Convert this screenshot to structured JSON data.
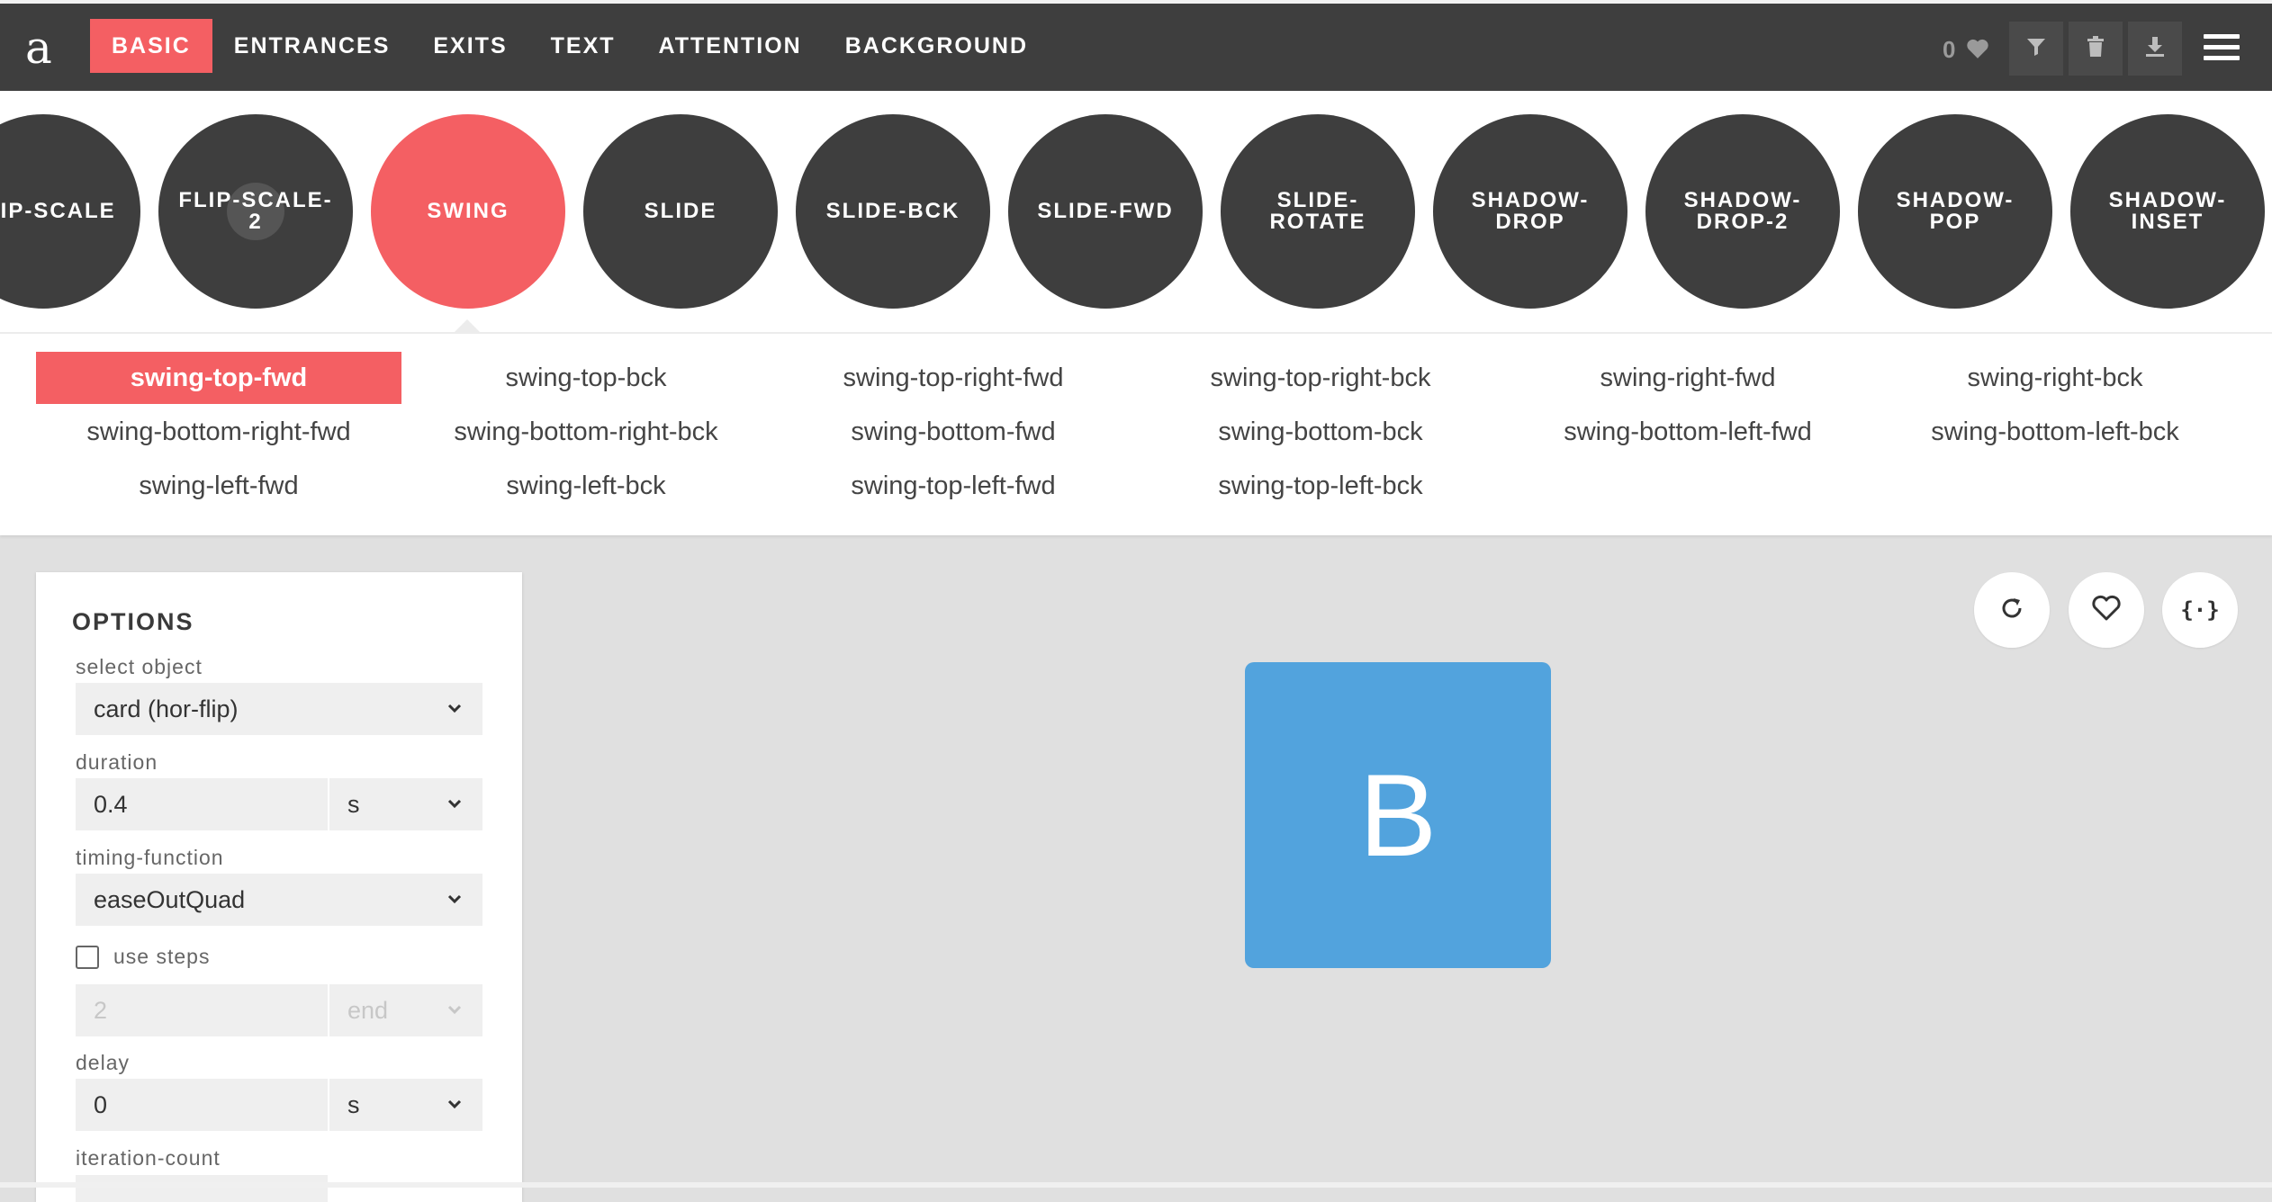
{
  "logo": "a",
  "nav": {
    "tabs": [
      {
        "label": "BASIC",
        "active": true
      },
      {
        "label": "ENTRANCES",
        "active": false
      },
      {
        "label": "EXITS",
        "active": false
      },
      {
        "label": "TEXT",
        "active": false
      },
      {
        "label": "ATTENTION",
        "active": false
      },
      {
        "label": "BACKGROUND",
        "active": false
      }
    ],
    "favorites_count": "0",
    "tools": [
      "filter-icon",
      "trash-icon",
      "download-icon"
    ],
    "menu_icon": "hamburger-icon"
  },
  "animations": [
    {
      "label": "FLIP-SCALE",
      "active": false
    },
    {
      "label": "FLIP-SCALE-2",
      "active": false
    },
    {
      "label": "SWING",
      "active": true
    },
    {
      "label": "SLIDE",
      "active": false
    },
    {
      "label": "SLIDE-BCK",
      "active": false
    },
    {
      "label": "SLIDE-FWD",
      "active": false
    },
    {
      "label": "SLIDE-ROTATE",
      "active": false
    },
    {
      "label": "SHADOW-DROP",
      "active": false
    },
    {
      "label": "SHADOW-DROP-2",
      "active": false
    },
    {
      "label": "SHADOW-POP",
      "active": false
    },
    {
      "label": "SHADOW-INSET",
      "active": false
    }
  ],
  "variants": [
    {
      "label": "swing-top-fwd",
      "active": true
    },
    {
      "label": "swing-top-bck"
    },
    {
      "label": "swing-top-right-fwd"
    },
    {
      "label": "swing-top-right-bck"
    },
    {
      "label": "swing-right-fwd"
    },
    {
      "label": "swing-right-bck"
    },
    {
      "label": "swing-bottom-right-fwd"
    },
    {
      "label": "swing-bottom-right-bck"
    },
    {
      "label": "swing-bottom-fwd"
    },
    {
      "label": "swing-bottom-bck"
    },
    {
      "label": "swing-bottom-left-fwd"
    },
    {
      "label": "swing-bottom-left-bck"
    },
    {
      "label": "swing-left-fwd"
    },
    {
      "label": "swing-left-bck"
    },
    {
      "label": "swing-top-left-fwd"
    },
    {
      "label": "swing-top-left-bck"
    }
  ],
  "options": {
    "title": "OPTIONS",
    "select_object": {
      "label": "select object",
      "value": "card (hor-flip)"
    },
    "duration": {
      "label": "duration",
      "value": "0.4",
      "unit": "s"
    },
    "timing_function": {
      "label": "timing-function",
      "value": "easeOutQuad"
    },
    "use_steps": {
      "label": "use steps",
      "checked": false,
      "value": "2",
      "position": "end"
    },
    "delay": {
      "label": "delay",
      "value": "0",
      "unit": "s"
    },
    "iteration_count": {
      "label": "iteration-count"
    }
  },
  "preview": {
    "card_letter": "B",
    "buttons": [
      "replay-icon",
      "heart-icon",
      "code-icon"
    ],
    "code_glyph": "{·}"
  },
  "colors": {
    "accent": "#f45f63",
    "dark": "#3e3e3e",
    "card": "#52a3dd",
    "background": "#e0e0e0"
  }
}
